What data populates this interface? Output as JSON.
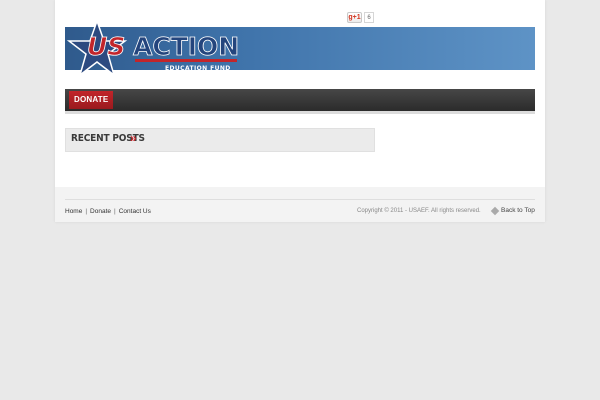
{
  "social": {
    "gplus_label": "g+1",
    "gplus_count": "6"
  },
  "header": {
    "logo_main": "US ACTION",
    "logo_sub": "EDUCATION FUND",
    "colors": {
      "banner": "#3e72a9",
      "logo_red": "#c2252a",
      "logo_blue": "#2c4a80"
    }
  },
  "nav": {
    "items": [
      {
        "label": "DONATE"
      }
    ]
  },
  "sidebar": {
    "recent_posts_title": "RECENT POSTS",
    "arrow_glyph": "»"
  },
  "footer": {
    "links": [
      "Home",
      "Donate",
      "Contact Us"
    ],
    "separator": "|",
    "copyright": "Copyright © 2011 - USAEF. All rights reserved.",
    "back_to_top": "Back to Top"
  }
}
